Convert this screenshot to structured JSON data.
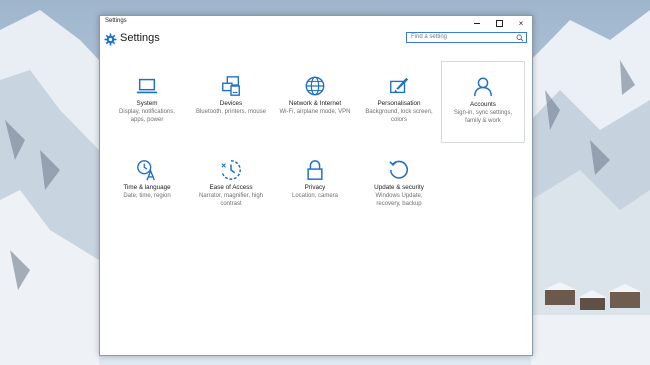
{
  "window": {
    "title": "Settings",
    "controls": {
      "minimize": "minimize",
      "maximize": "maximize",
      "close": "×"
    }
  },
  "header": {
    "title": "Settings",
    "search_placeholder": "Find a setting"
  },
  "tiles": [
    {
      "label": "System",
      "desc": "Display, notifications, apps, power",
      "icon": "laptop-icon"
    },
    {
      "label": "Devices",
      "desc": "Bluetooth, printers, mouse",
      "icon": "devices-icon"
    },
    {
      "label": "Network & Internet",
      "desc": "Wi-Fi, airplane mode, VPN",
      "icon": "globe-icon"
    },
    {
      "label": "Personalisation",
      "desc": "Background, lock screen, colors",
      "icon": "paint-icon"
    },
    {
      "label": "Accounts",
      "desc": "Sign-in, sync settings, family & work",
      "icon": "person-icon"
    },
    {
      "label": "Time & language",
      "desc": "Date, time, region",
      "icon": "clock-language-icon"
    },
    {
      "label": "Ease of Access",
      "desc": "Narrator, magnifier, high contrast",
      "icon": "ease-of-access-icon"
    },
    {
      "label": "Privacy",
      "desc": "Location, camera",
      "icon": "lock-icon"
    },
    {
      "label": "Update & security",
      "desc": "Windows Update, recovery, backup",
      "icon": "update-icon"
    }
  ],
  "colors": {
    "accent": "#1e6fc6",
    "selected_border": "#d5d9de"
  }
}
